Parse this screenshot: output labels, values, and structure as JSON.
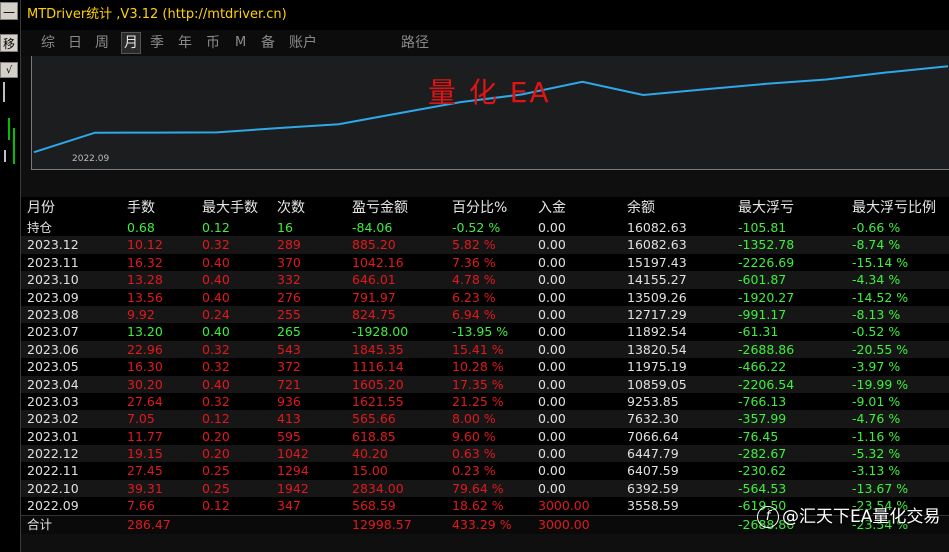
{
  "window": {
    "title": "MTDriver统计 ,V3.12 (http://mtdriver.cn)"
  },
  "left_strip": {
    "button_top": "—",
    "button_move": "移",
    "check": "√"
  },
  "tabs": [
    {
      "label": "综",
      "active": false
    },
    {
      "label": "日",
      "active": false
    },
    {
      "label": "周",
      "active": false
    },
    {
      "label": "月",
      "active": true
    },
    {
      "label": "季",
      "active": false
    },
    {
      "label": "年",
      "active": false
    },
    {
      "label": "币",
      "active": false
    },
    {
      "label": "M",
      "active": false
    },
    {
      "label": "备",
      "active": false
    },
    {
      "label": "账户",
      "active": false
    },
    {
      "label": "路径",
      "active": false
    }
  ],
  "chart": {
    "watermark": "量 化 EA",
    "x_label": "2022.09",
    "line_color": "#2ea8e8",
    "chart_data": {
      "type": "line",
      "x": [
        "2022.09",
        "2022.10",
        "2022.11",
        "2022.12",
        "2023.01",
        "2023.02",
        "2023.03",
        "2023.04",
        "2023.05",
        "2023.06",
        "2023.07",
        "2023.08",
        "2023.09",
        "2023.10",
        "2023.11",
        "2023.12"
      ],
      "values": [
        3558.59,
        6392.59,
        6407.59,
        6447.79,
        7066.64,
        7632.3,
        9253.85,
        10859.05,
        11975.19,
        13820.54,
        11892.54,
        12717.29,
        13509.26,
        14155.27,
        15197.43,
        16082.63
      ]
    }
  },
  "table": {
    "headers": [
      "月份",
      "手数",
      "最大手数",
      "次数",
      "盈亏金额",
      "百分比%",
      "入金",
      "余额",
      "最大浮亏",
      "最大浮亏比例"
    ],
    "position_row": {
      "label": "持仓",
      "cells": [
        "0.68",
        "0.12",
        "16",
        "-84.06",
        "-0.52 %",
        "0.00",
        "16082.63",
        "-105.81",
        "-0.66 %"
      ],
      "colors": [
        "grn",
        "grn",
        "grn",
        "grn",
        "grn",
        "wht",
        "wht",
        "grn",
        "grn"
      ]
    },
    "rows": [
      {
        "month": "2023.12",
        "cells": [
          "10.12",
          "0.32",
          "289",
          "885.20",
          "5.82 %",
          "0.00",
          "16082.63",
          "-1352.78",
          "-8.74 %"
        ],
        "colors": [
          "red",
          "red",
          "red",
          "red",
          "red",
          "wht",
          "wht",
          "grn",
          "grn"
        ]
      },
      {
        "month": "2023.11",
        "cells": [
          "16.32",
          "0.40",
          "370",
          "1042.16",
          "7.36 %",
          "0.00",
          "15197.43",
          "-2226.69",
          "-15.14 %"
        ],
        "colors": [
          "red",
          "red",
          "red",
          "red",
          "red",
          "wht",
          "wht",
          "grn",
          "grn"
        ]
      },
      {
        "month": "2023.10",
        "cells": [
          "13.28",
          "0.40",
          "332",
          "646.01",
          "4.78 %",
          "0.00",
          "14155.27",
          "-601.87",
          "-4.34 %"
        ],
        "colors": [
          "red",
          "red",
          "red",
          "red",
          "red",
          "wht",
          "wht",
          "grn",
          "grn"
        ]
      },
      {
        "month": "2023.09",
        "cells": [
          "13.56",
          "0.40",
          "276",
          "791.97",
          "6.23 %",
          "0.00",
          "13509.26",
          "-1920.27",
          "-14.52 %"
        ],
        "colors": [
          "red",
          "red",
          "red",
          "red",
          "red",
          "wht",
          "wht",
          "grn",
          "grn"
        ]
      },
      {
        "month": "2023.08",
        "cells": [
          "9.92",
          "0.24",
          "255",
          "824.75",
          "6.94 %",
          "0.00",
          "12717.29",
          "-991.17",
          "-8.13 %"
        ],
        "colors": [
          "red",
          "red",
          "red",
          "red",
          "red",
          "wht",
          "wht",
          "grn",
          "grn"
        ]
      },
      {
        "month": "2023.07",
        "cells": [
          "13.20",
          "0.40",
          "265",
          "-1928.00",
          "-13.95 %",
          "0.00",
          "11892.54",
          "-61.31",
          "-0.52 %"
        ],
        "colors": [
          "grn",
          "grn",
          "grn",
          "grn",
          "grn",
          "wht",
          "wht",
          "grn",
          "grn"
        ]
      },
      {
        "month": "2023.06",
        "cells": [
          "22.96",
          "0.32",
          "543",
          "1845.35",
          "15.41 %",
          "0.00",
          "13820.54",
          "-2688.86",
          "-20.55 %"
        ],
        "colors": [
          "red",
          "red",
          "red",
          "red",
          "red",
          "wht",
          "wht",
          "grn",
          "grn"
        ]
      },
      {
        "month": "2023.05",
        "cells": [
          "16.30",
          "0.32",
          "372",
          "1116.14",
          "10.28 %",
          "0.00",
          "11975.19",
          "-466.22",
          "-3.97 %"
        ],
        "colors": [
          "red",
          "red",
          "red",
          "red",
          "red",
          "wht",
          "wht",
          "grn",
          "grn"
        ]
      },
      {
        "month": "2023.04",
        "cells": [
          "30.20",
          "0.40",
          "721",
          "1605.20",
          "17.35 %",
          "0.00",
          "10859.05",
          "-2206.54",
          "-19.99 %"
        ],
        "colors": [
          "red",
          "red",
          "red",
          "red",
          "red",
          "wht",
          "wht",
          "grn",
          "grn"
        ]
      },
      {
        "month": "2023.03",
        "cells": [
          "27.64",
          "0.32",
          "936",
          "1621.55",
          "21.25 %",
          "0.00",
          "9253.85",
          "-766.13",
          "-9.01 %"
        ],
        "colors": [
          "red",
          "red",
          "red",
          "red",
          "red",
          "wht",
          "wht",
          "grn",
          "grn"
        ]
      },
      {
        "month": "2023.02",
        "cells": [
          "7.05",
          "0.12",
          "413",
          "565.66",
          "8.00 %",
          "0.00",
          "7632.30",
          "-357.99",
          "-4.76 %"
        ],
        "colors": [
          "red",
          "red",
          "red",
          "red",
          "red",
          "wht",
          "wht",
          "grn",
          "grn"
        ]
      },
      {
        "month": "2023.01",
        "cells": [
          "11.77",
          "0.20",
          "595",
          "618.85",
          "9.60 %",
          "0.00",
          "7066.64",
          "-76.45",
          "-1.16 %"
        ],
        "colors": [
          "red",
          "red",
          "red",
          "red",
          "red",
          "wht",
          "wht",
          "grn",
          "grn"
        ]
      },
      {
        "month": "2022.12",
        "cells": [
          "19.15",
          "0.20",
          "1042",
          "40.20",
          "0.63 %",
          "0.00",
          "6447.79",
          "-282.67",
          "-5.32 %"
        ],
        "colors": [
          "red",
          "red",
          "red",
          "red",
          "red",
          "wht",
          "wht",
          "grn",
          "grn"
        ]
      },
      {
        "month": "2022.11",
        "cells": [
          "27.45",
          "0.25",
          "1294",
          "15.00",
          "0.23 %",
          "0.00",
          "6407.59",
          "-230.62",
          "-3.13 %"
        ],
        "colors": [
          "red",
          "red",
          "red",
          "red",
          "red",
          "wht",
          "wht",
          "grn",
          "grn"
        ]
      },
      {
        "month": "2022.10",
        "cells": [
          "39.31",
          "0.25",
          "1942",
          "2834.00",
          "79.64 %",
          "0.00",
          "6392.59",
          "-564.53",
          "-13.67 %"
        ],
        "colors": [
          "red",
          "red",
          "red",
          "red",
          "red",
          "wht",
          "wht",
          "grn",
          "grn"
        ]
      },
      {
        "month": "2022.09",
        "cells": [
          "7.66",
          "0.12",
          "347",
          "568.59",
          "18.62 %",
          "3000.00",
          "3558.59",
          "-619.50",
          "-23.54 %"
        ],
        "colors": [
          "red",
          "red",
          "red",
          "red",
          "red",
          "red",
          "wht",
          "grn",
          "grn"
        ]
      }
    ],
    "total_row": {
      "label": "合计",
      "cells": [
        "286.47",
        "",
        "",
        "12998.57",
        "433.29 %",
        "3000.00",
        "",
        "-2688.86",
        "-23.54 %"
      ],
      "colors": [
        "red",
        "red",
        "red",
        "red",
        "red",
        "red",
        "wht",
        "grn",
        "grn"
      ]
    }
  },
  "credit": {
    "logo": "f",
    "text": "@汇天下EA量化交易"
  },
  "colors": {
    "red": "#e0191e",
    "green": "#3cf03c",
    "title": "#ffd200"
  }
}
